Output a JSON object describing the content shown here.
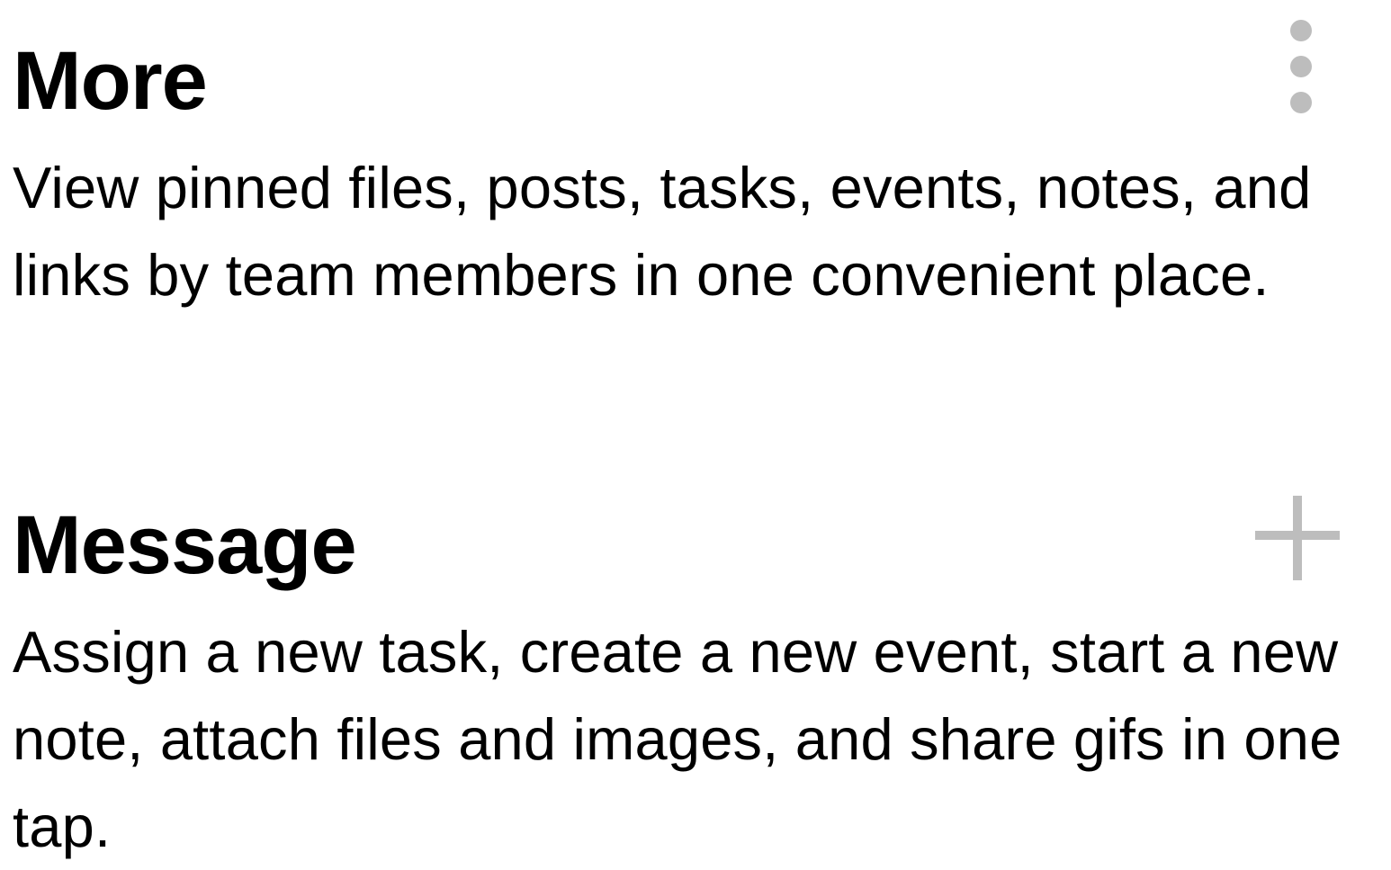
{
  "sections": [
    {
      "title": "More",
      "description": "View pinned files, posts, tasks, events, notes, and links by team members in one convenient place.",
      "icon": "vertical-ellipsis-icon"
    },
    {
      "title": "Message",
      "description": "Assign a new task, create a new event, start a new note, attach files and images, and share gifs in one tap.",
      "icon": "plus-icon"
    }
  ],
  "colors": {
    "text": "#000000",
    "icon": "#bdbdbd",
    "background": "#ffffff"
  }
}
